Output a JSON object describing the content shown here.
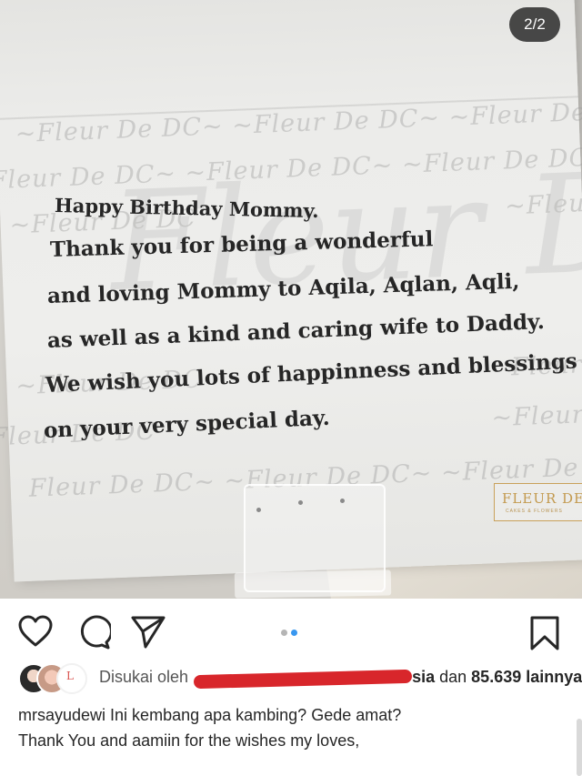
{
  "photo": {
    "counter": "2/2",
    "watermark": "Fleur De DC",
    "card_lines": [
      "Happy Birthday Mommy.",
      "Thank you for being a wonderful",
      "and loving Mommy to Aqila, Aqlan, Aqli,",
      "as well as a kind and caring wife to Daddy.",
      "We wish you lots of happinness and blessings",
      "on your very special day."
    ],
    "brand_label": "FLEUR DE",
    "brand_sub": "CAKES & FLOWERS"
  },
  "actions": {
    "like_icon": "heart-icon",
    "comment_icon": "comment-icon",
    "share_icon": "paper-plane-icon",
    "save_icon": "bookmark-icon",
    "carousel_active_index": 2,
    "carousel_count": 2
  },
  "likes": {
    "prefix": "Disukai oleh",
    "name_partial": "sia",
    "connector": "dan",
    "count": "85.639",
    "suffix": "lainnya"
  },
  "caption": {
    "username": "mrsayudewi",
    "line1": "Ini kembang apa kambing? Gede amat?",
    "line2": "Thank You and aamiin for the wishes my loves,"
  },
  "colors": {
    "accent": "#3897f0",
    "text": "#262626",
    "redaction": "#d8262b"
  }
}
